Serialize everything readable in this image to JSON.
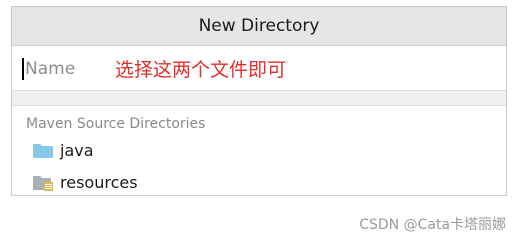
{
  "dialog": {
    "title": "New Directory",
    "name_placeholder": "Name",
    "annotation": "选择这两个文件即可",
    "section_label": "Maven Source Directories",
    "items": [
      {
        "label": "java",
        "icon": "folder-icon"
      },
      {
        "label": "resources",
        "icon": "resources-folder-icon"
      }
    ]
  },
  "watermark": "CSDN @Cata卡塔丽娜",
  "colors": {
    "annotation": "#e0302b",
    "folder_blue": "#87c7e8",
    "folder_gray": "#a9b0b6",
    "resource_badge": "#e3b64c"
  }
}
